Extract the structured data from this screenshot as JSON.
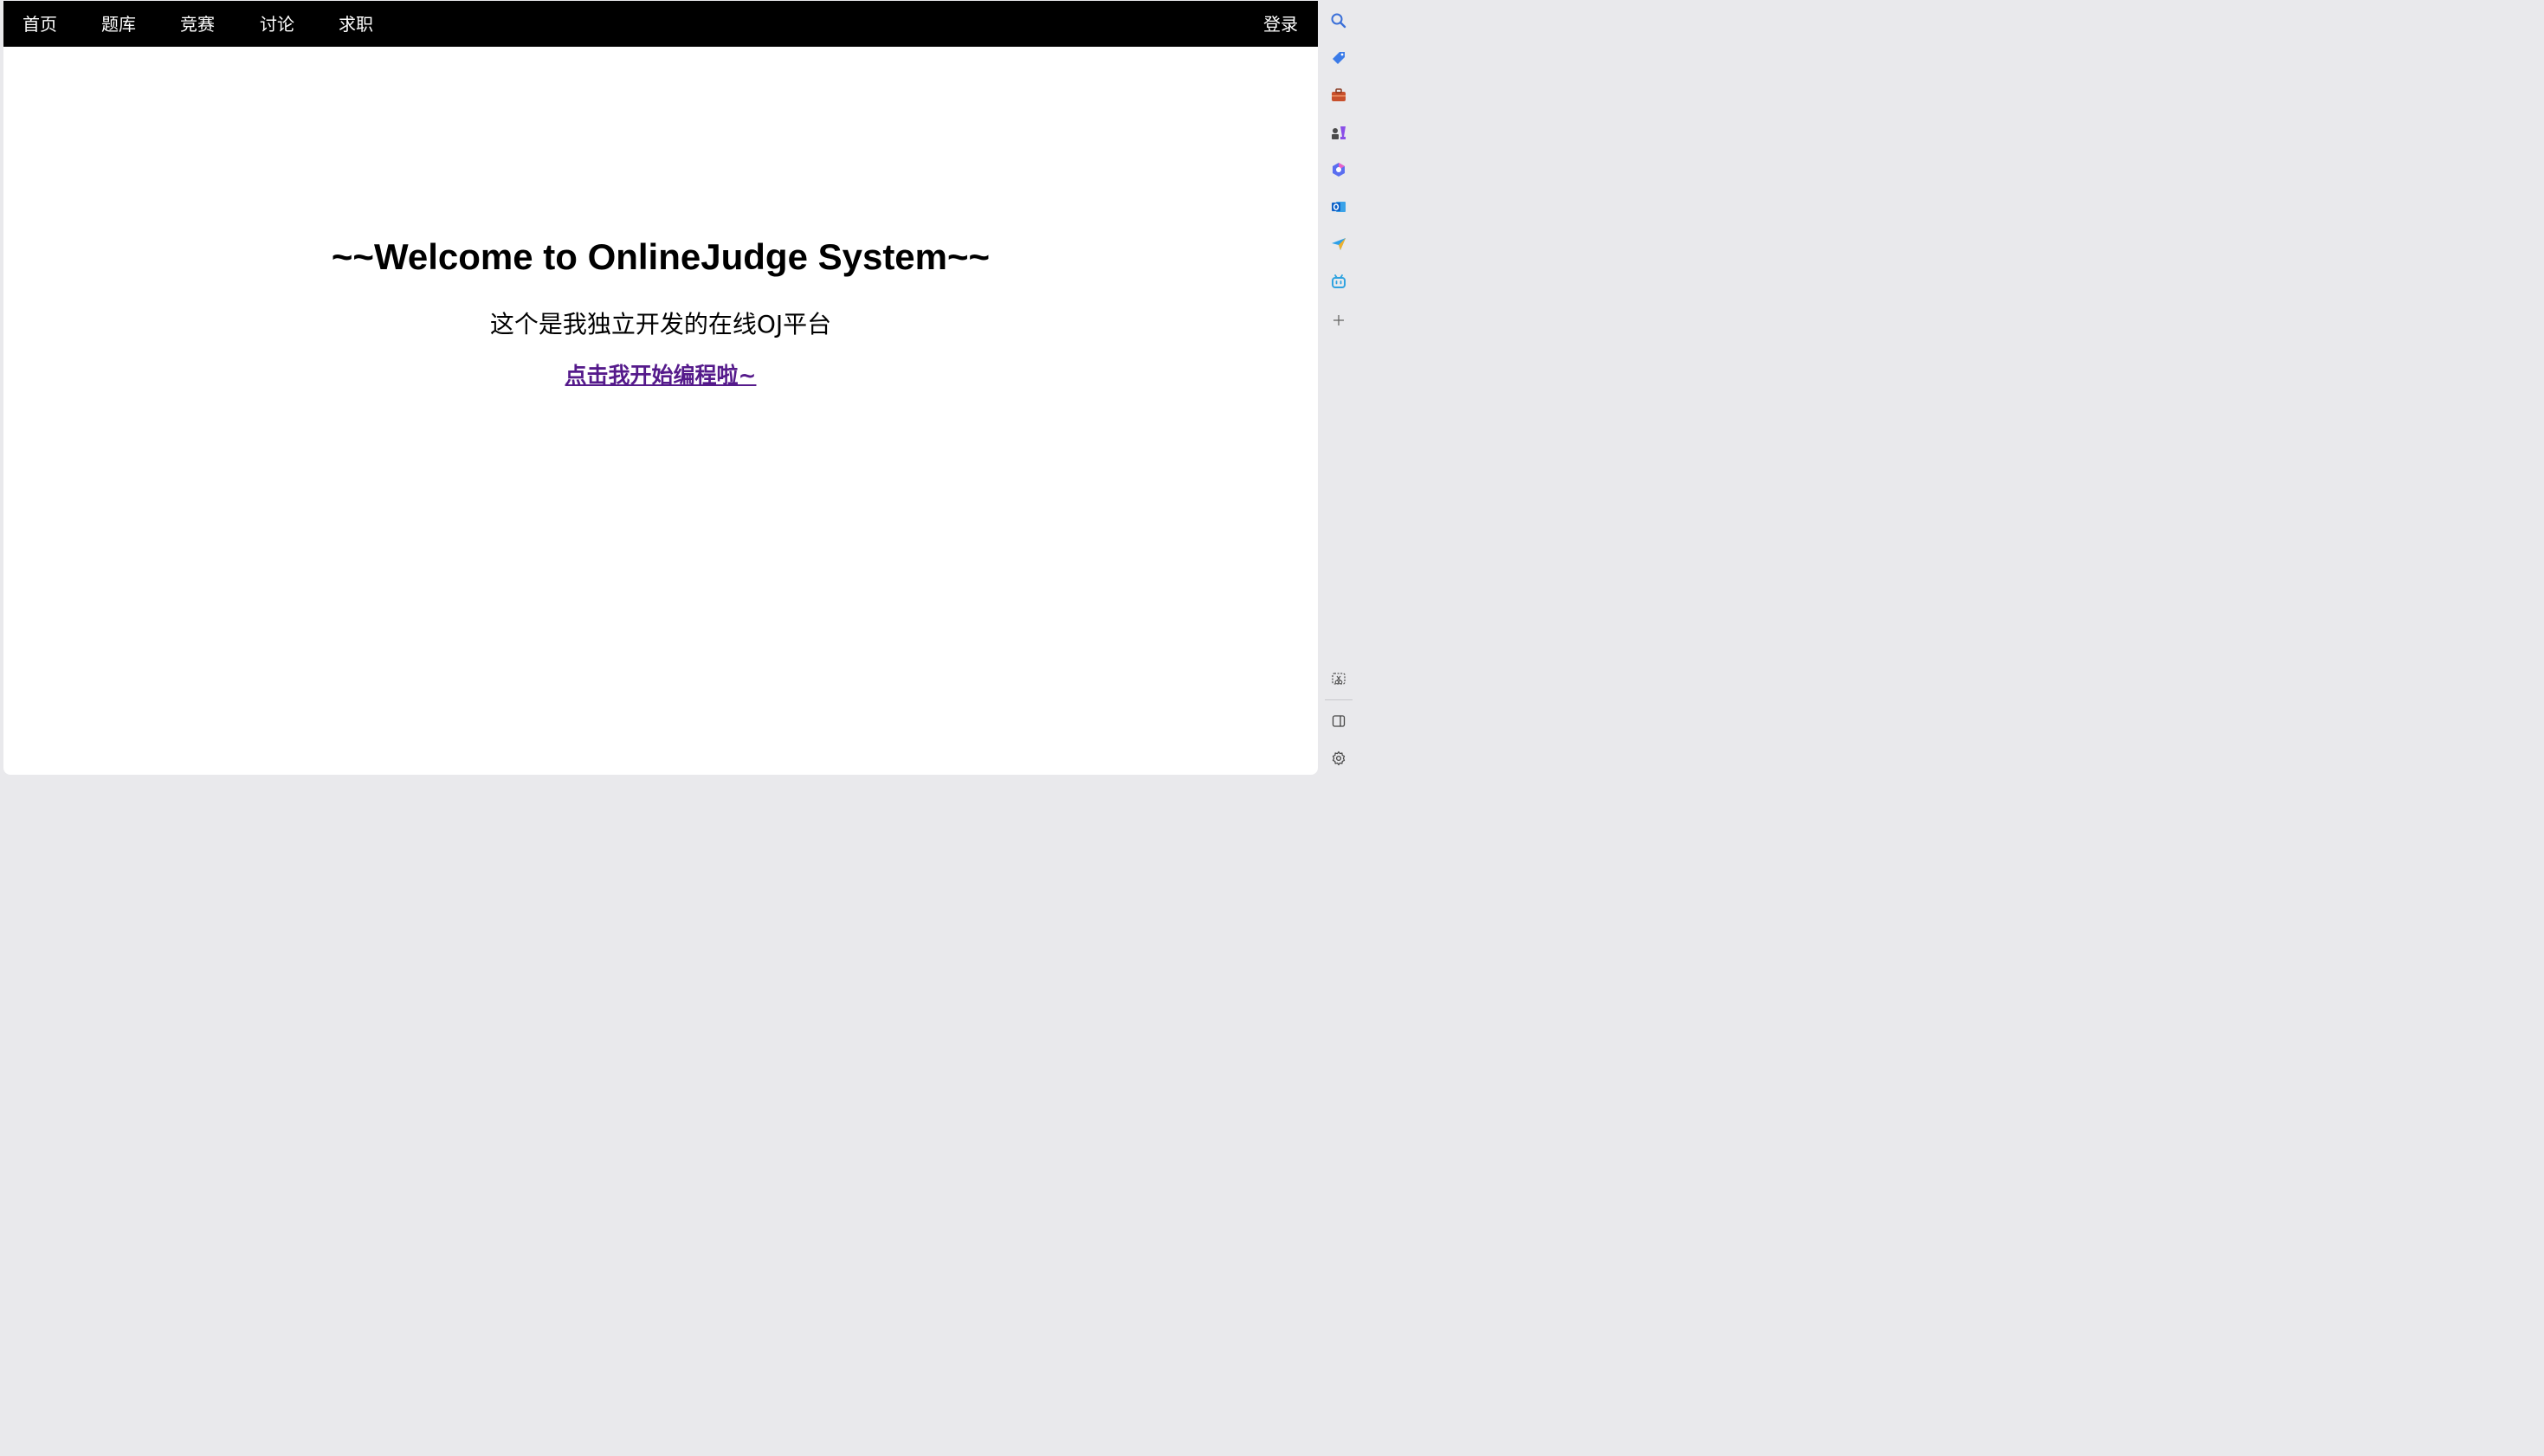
{
  "nav": {
    "items": [
      {
        "label": "首页"
      },
      {
        "label": "题库"
      },
      {
        "label": "竞赛"
      },
      {
        "label": "讨论"
      },
      {
        "label": "求职"
      }
    ],
    "login_label": "登录"
  },
  "hero": {
    "title": "~~Welcome to OnlineJudge System~~",
    "subtitle": "这个是我独立开发的在线OJ平台",
    "link_text": "点击我开始编程啦~"
  },
  "colors": {
    "navbar_bg": "#000000",
    "link_visited": "#551a8b"
  },
  "sidebar": {
    "icons": [
      "search-icon",
      "tag-icon",
      "toolbox-icon",
      "chess-icon",
      "copilot-icon",
      "outlook-icon",
      "send-icon",
      "bilibili-icon",
      "add-icon",
      "screenshot-icon",
      "split-view-icon",
      "settings-icon"
    ]
  }
}
